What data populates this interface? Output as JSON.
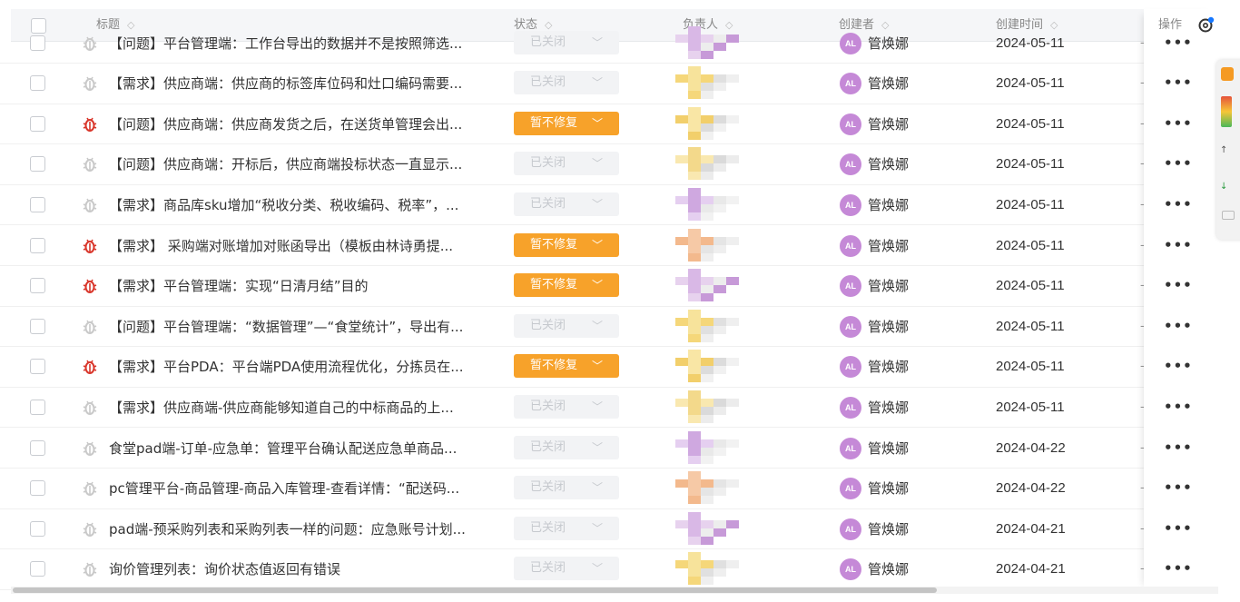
{
  "header": {
    "title": "标题",
    "status": "状态",
    "assignee": "负责人",
    "creator": "创建者",
    "created_time": "创建时间",
    "actions": "操作"
  },
  "rows": [
    {
      "title": "【问题】平台管理端：工作台导出的数据并不是按照筛选...",
      "status": "已关闭",
      "status_type": "closed",
      "avatar": "AL",
      "creator": "管焕娜",
      "date": "2024-05-11"
    },
    {
      "title": "【需求】供应商端：供应商的标签库位码和灶口编码需要...",
      "status": "已关闭",
      "status_type": "closed",
      "avatar": "AL",
      "creator": "管焕娜",
      "date": "2024-05-11"
    },
    {
      "title": "【问题】供应商端：供应商发货之后，在送货单管理会出...",
      "status": "暂不修复",
      "status_type": "paused",
      "avatar": "AL",
      "creator": "管焕娜",
      "date": "2024-05-11"
    },
    {
      "title": "【问题】供应商端：开标后，供应商端投标状态一直显示...",
      "status": "已关闭",
      "status_type": "closed",
      "avatar": "AL",
      "creator": "管焕娜",
      "date": "2024-05-11"
    },
    {
      "title": "【需求】商品库sku增加“税收分类、税收编码、税率”，...",
      "status": "已关闭",
      "status_type": "closed",
      "avatar": "AL",
      "creator": "管焕娜",
      "date": "2024-05-11"
    },
    {
      "title": "【需求】 采购端对账增加对账函导出（模板由林诗勇提...",
      "status": "暂不修复",
      "status_type": "paused",
      "avatar": "AL",
      "creator": "管焕娜",
      "date": "2024-05-11"
    },
    {
      "title": "【需求】平台管理端：实现“日清月结”目的",
      "status": "暂不修复",
      "status_type": "paused",
      "avatar": "AL",
      "creator": "管焕娜",
      "date": "2024-05-11"
    },
    {
      "title": "【问题】平台管理端：“数据管理”—“食堂统计”，导出有...",
      "status": "已关闭",
      "status_type": "closed",
      "avatar": "AL",
      "creator": "管焕娜",
      "date": "2024-05-11"
    },
    {
      "title": "【需求】平台PDA：平台端PDA使用流程优化，分拣员在...",
      "status": "暂不修复",
      "status_type": "paused",
      "avatar": "AL",
      "creator": "管焕娜",
      "date": "2024-05-11"
    },
    {
      "title": "【需求】供应商端-供应商能够知道自己的中标商品的上...",
      "status": "已关闭",
      "status_type": "closed",
      "avatar": "AL",
      "creator": "管焕娜",
      "date": "2024-05-11"
    },
    {
      "title": "食堂pad端-订单-应急单：管理平台确认配送应急单商品...",
      "status": "已关闭",
      "status_type": "closed",
      "avatar": "AL",
      "creator": "管焕娜",
      "date": "2024-04-22"
    },
    {
      "title": "pc管理平台-商品管理-商品入库管理-查看详情：“配送码...",
      "status": "已关闭",
      "status_type": "closed",
      "avatar": "AL",
      "creator": "管焕娜",
      "date": "2024-04-22"
    },
    {
      "title": "pad端-预采购列表和采购列表一样的问题：应急账号计划...",
      "status": "已关闭",
      "status_type": "closed",
      "avatar": "AL",
      "creator": "管焕娜",
      "date": "2024-04-21"
    },
    {
      "title": "询价管理列表：询价状态值返回有错误",
      "status": "已关闭",
      "status_type": "closed",
      "avatar": "AL",
      "creator": "管焕娜",
      "date": "2024-04-21"
    }
  ],
  "more_label": "•••",
  "dash": "-",
  "colors": {
    "paused": "#f7a22a",
    "closed_bg": "#f2f3f5",
    "avatar": "#c589d7",
    "bug_active": "#d9362b",
    "bug_muted": "#c9c9c9"
  }
}
